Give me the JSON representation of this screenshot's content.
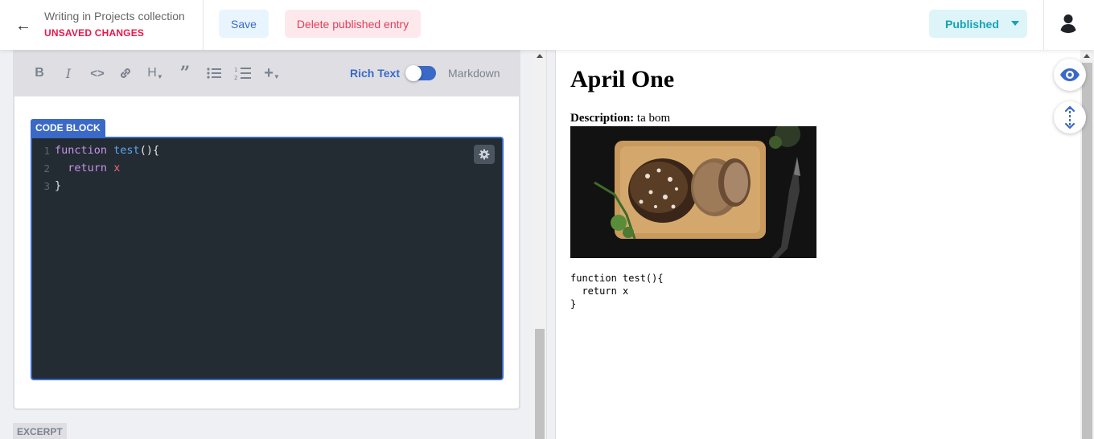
{
  "header": {
    "title": "Writing in Projects collection",
    "status": "UNSAVED CHANGES",
    "save_label": "Save",
    "delete_label": "Delete published entry",
    "publish_label": "Published"
  },
  "editor": {
    "toolbar": {
      "bold": "B",
      "italic": "I",
      "code": "<>",
      "heading": "H",
      "quote": "”",
      "add": "+",
      "rich_text_label": "Rich Text",
      "markdown_label": "Markdown",
      "mode": "rich-text"
    },
    "code_block_label": "CODE BLOCK",
    "code_lines": [
      {
        "num": "1",
        "text": "function test(){"
      },
      {
        "num": "2",
        "text": "  return x"
      },
      {
        "num": "3",
        "text": "}"
      }
    ],
    "next_field_label": "EXCERPT"
  },
  "preview": {
    "title": "April One",
    "description_label": "Description:",
    "description_value": "ta bom",
    "image_alt": "bread on a cutting board",
    "code": "function test(){\n  return x\n}"
  },
  "icons": {
    "back": "arrow-left-icon",
    "avatar": "user-icon",
    "gear": "gear-icon",
    "eye": "eye-icon",
    "sync": "sync-scroll-icon"
  },
  "colors": {
    "accent": "#3a69c7",
    "danger": "#e8174a",
    "published": "#17a2b8",
    "code_bg": "#232b33"
  }
}
